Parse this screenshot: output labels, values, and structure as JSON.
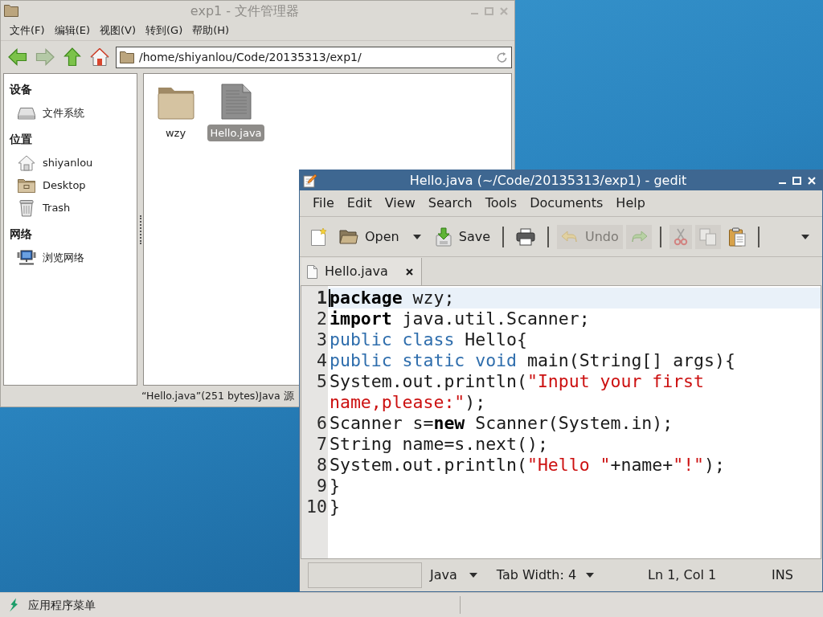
{
  "file_manager": {
    "active": false,
    "title": "exp1 - 文件管理器",
    "menu": [
      "文件(F)",
      "编辑(E)",
      "视图(V)",
      "转到(G)",
      "帮助(H)"
    ],
    "nav_buttons": [
      {
        "disabled": false
      },
      {
        "disabled": true
      },
      {
        "disabled": false
      },
      {
        "disabled": false
      }
    ],
    "address": "/home/shiyanlou/Code/20135313/exp1/",
    "sidebar": [
      {
        "title": "设备",
        "items": [
          {
            "label": "文件系统"
          }
        ]
      },
      {
        "title": "位置",
        "items": [
          {
            "label": "shiyanlou"
          },
          {
            "label": "Desktop"
          },
          {
            "label": "Trash"
          }
        ]
      },
      {
        "title": "网络",
        "items": [
          {
            "label": "浏览网络"
          }
        ]
      }
    ],
    "files": [
      {
        "kind": "folder",
        "name": "wzy",
        "selected": false
      },
      {
        "kind": "file",
        "name": "Hello.java",
        "selected": true
      }
    ],
    "status_bar": "“Hello.java”(251 bytes)Java 源"
  },
  "gedit": {
    "active": true,
    "title": "Hello.java (~/Code/20135313/exp1) - gedit",
    "menu": [
      "File",
      "Edit",
      "View",
      "Search",
      "Tools",
      "Documents",
      "Help"
    ],
    "toolbar": [
      {
        "kind": "button",
        "disabled": false
      },
      {
        "kind": "button",
        "label": "Open",
        "disabled": false
      },
      {
        "kind": "menu"
      },
      {
        "kind": "button",
        "label": "Save",
        "disabled": false
      },
      {
        "kind": "separator"
      },
      {
        "kind": "button",
        "disabled": false
      },
      {
        "kind": "separator"
      },
      {
        "kind": "button",
        "label": "Undo",
        "disabled": true
      },
      {
        "kind": "button",
        "disabled": true
      },
      {
        "kind": "separator"
      },
      {
        "kind": "button",
        "disabled": true
      },
      {
        "kind": "button",
        "disabled": true
      },
      {
        "kind": "button",
        "disabled": false
      },
      {
        "kind": "separator"
      },
      {
        "kind": "overflow"
      }
    ],
    "tabs": [
      {
        "label": "Hello.java",
        "selected": true
      }
    ],
    "lines": [
      {
        "number": "1",
        "current": true,
        "tokens": [
          {
            "kind": "keyword",
            "text": "package"
          },
          {
            "kind": "plain",
            "text": " wzy;"
          }
        ]
      },
      {
        "number": "2",
        "current": false,
        "tokens": [
          {
            "kind": "keyword",
            "text": "import"
          },
          {
            "kind": "plain",
            "text": " java.util.Scanner;"
          }
        ]
      },
      {
        "number": "3",
        "current": false,
        "tokens": [
          {
            "kind": "type",
            "text": "public class"
          },
          {
            "kind": "plain",
            "text": " Hello{"
          }
        ]
      },
      {
        "number": "4",
        "current": false,
        "tokens": [
          {
            "kind": "type",
            "text": "public static void"
          },
          {
            "kind": "plain",
            "text": " main(String[] args){"
          }
        ]
      },
      {
        "number": "5",
        "current": false,
        "tokens": [
          {
            "kind": "plain",
            "text": "System.out.println("
          },
          {
            "kind": "string",
            "text": "\"Input your first name,please:\""
          },
          {
            "kind": "plain",
            "text": ");"
          }
        ]
      },
      {
        "number": "6",
        "current": false,
        "tokens": [
          {
            "kind": "plain",
            "text": "Scanner s="
          },
          {
            "kind": "keyword",
            "text": "new"
          },
          {
            "kind": "plain",
            "text": " Scanner(System.in);"
          }
        ]
      },
      {
        "number": "7",
        "current": false,
        "tokens": [
          {
            "kind": "plain",
            "text": "String name=s.next();"
          }
        ]
      },
      {
        "number": "8",
        "current": false,
        "tokens": [
          {
            "kind": "plain",
            "text": "System.out.println("
          },
          {
            "kind": "string",
            "text": "\"Hello \""
          },
          {
            "kind": "plain",
            "text": "+name+"
          },
          {
            "kind": "string",
            "text": "\"!\""
          },
          {
            "kind": "plain",
            "text": ");"
          }
        ]
      },
      {
        "number": "9",
        "current": false,
        "tokens": [
          {
            "kind": "plain",
            "text": "}"
          }
        ]
      },
      {
        "number": "10",
        "current": false,
        "tokens": [
          {
            "kind": "plain",
            "text": "}"
          }
        ]
      }
    ],
    "status_bar": {
      "language": "Java",
      "tab_width": "Tab Width: 4",
      "position": "Ln 1, Col 1",
      "mode": "INS"
    }
  },
  "taskbar": {
    "menu_label": "应用程序菜单"
  }
}
